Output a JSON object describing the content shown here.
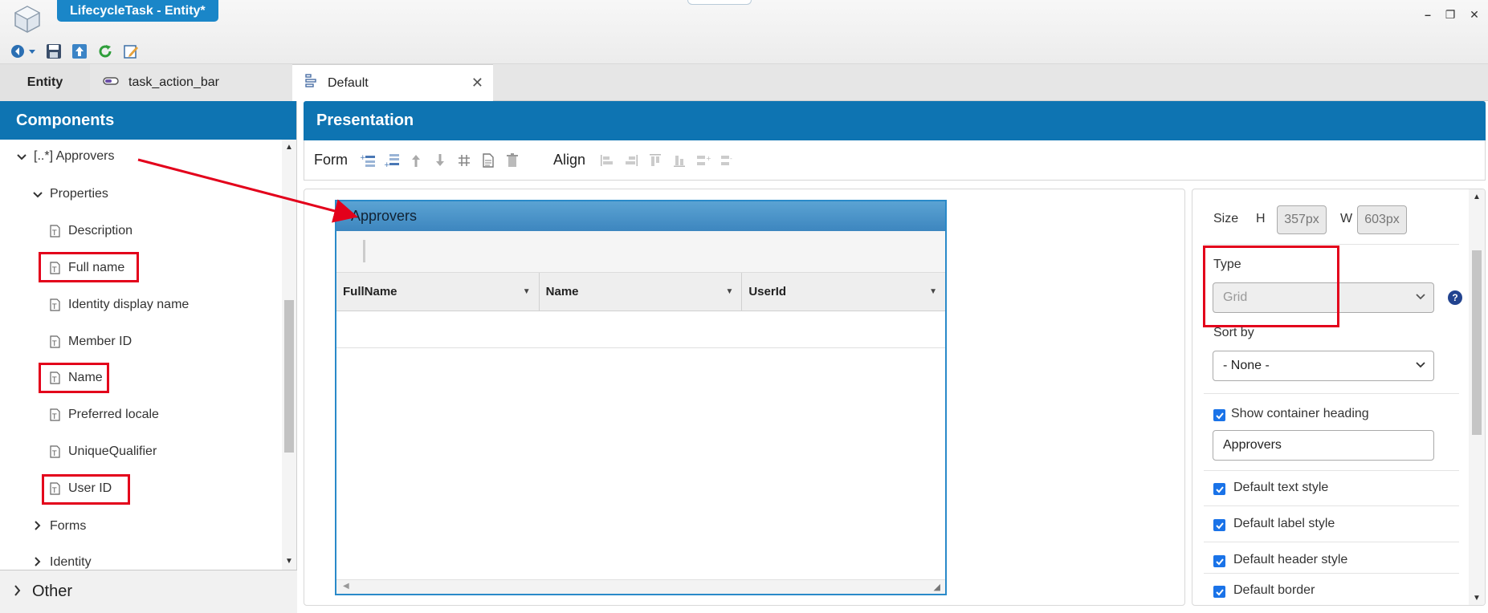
{
  "window": {
    "title": "LifecycleTask - Entity*",
    "minimize_icon": "minimize-icon",
    "restore_icon": "restore-icon",
    "close_icon": "close-icon"
  },
  "toolbar": {
    "icons": [
      "back-icon",
      "save-icon",
      "publish-icon",
      "refresh-icon",
      "edit-icon"
    ]
  },
  "tabs": {
    "entity": "Entity",
    "action_bar": "task_action_bar",
    "default": "Default"
  },
  "components": {
    "header": "Components",
    "approvers": "[..*] Approvers",
    "properties": "Properties",
    "items": [
      "Description",
      "Full name",
      "Identity display name",
      "Member ID",
      "Name",
      "Preferred locale",
      "UniqueQualifier",
      "User ID"
    ],
    "forms": "Forms",
    "identity": "Identity",
    "other": "Other"
  },
  "presentation": {
    "header": "Presentation",
    "form_label": "Form",
    "align_label": "Align"
  },
  "grid": {
    "title": "Approvers",
    "columns": [
      "FullName",
      "Name",
      "UserId"
    ]
  },
  "props": {
    "size_label": "Size",
    "h_label": "H",
    "h_value": "357px",
    "w_label": "W",
    "w_value": "603px",
    "type_label": "Type",
    "type_value": "Grid",
    "sortby_label": "Sort by",
    "sortby_value": "- None -",
    "show_heading_label": "Show container heading",
    "heading_value": "Approvers",
    "default_text_style": "Default text style",
    "default_label_style": "Default label style",
    "default_header_style": "Default header style",
    "default_border": "Default border"
  },
  "colors": {
    "accent": "#0e74b2",
    "title_pill": "#1a86c8",
    "highlight": "#e3001b",
    "checkbox": "#1a73e8"
  }
}
